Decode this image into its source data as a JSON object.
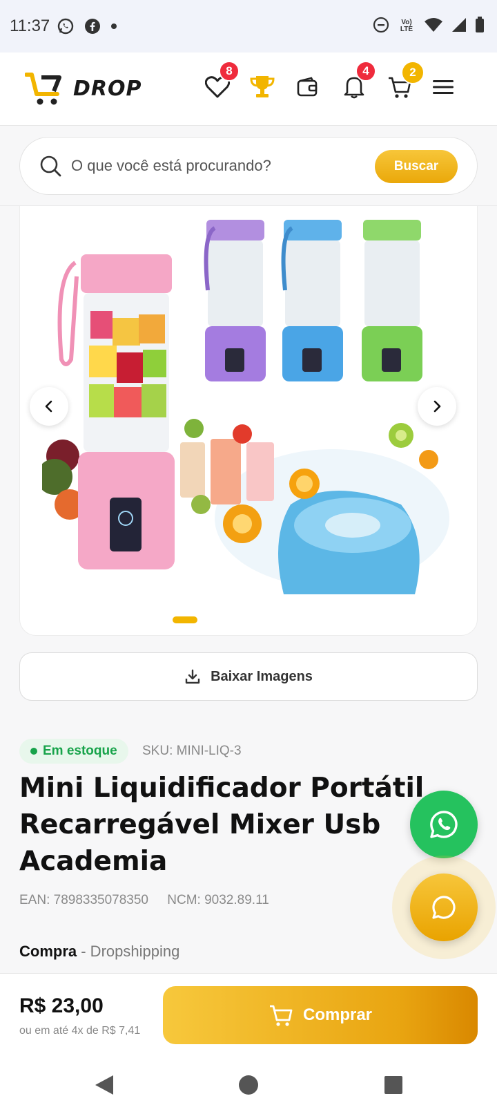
{
  "status_bar": {
    "time": "11:37",
    "lte_label": "Vo) LTE"
  },
  "header": {
    "logo_text": "DROP",
    "badges": {
      "wishlist": "8",
      "notifications": "4",
      "cart": "2"
    }
  },
  "search": {
    "placeholder": "O que você está procurando?",
    "button_label": "Buscar"
  },
  "gallery": {
    "active_index": 0,
    "total": 1
  },
  "download": {
    "label": "Baixar Imagens"
  },
  "product": {
    "stock_label": "Em estoque",
    "sku": "SKU: MINI-LIQ-3",
    "title": "Mini Liquidificador Portátil Recarregável Mixer Usb Academia",
    "ean": "EAN: 7898335078350",
    "ncm": "NCM: 9032.89.11",
    "purchase_type_label": "Compra",
    "purchase_type_value": " - Dropshipping"
  },
  "buy_bar": {
    "price": "R$ 23,00",
    "installments": "ou em até 4x de R$ 7,41",
    "buy_label": "Comprar"
  },
  "colors": {
    "accent": "#F2B500",
    "whatsapp": "#25C25E",
    "badge_red": "#EF2B3C",
    "stock_green": "#17A34A"
  }
}
